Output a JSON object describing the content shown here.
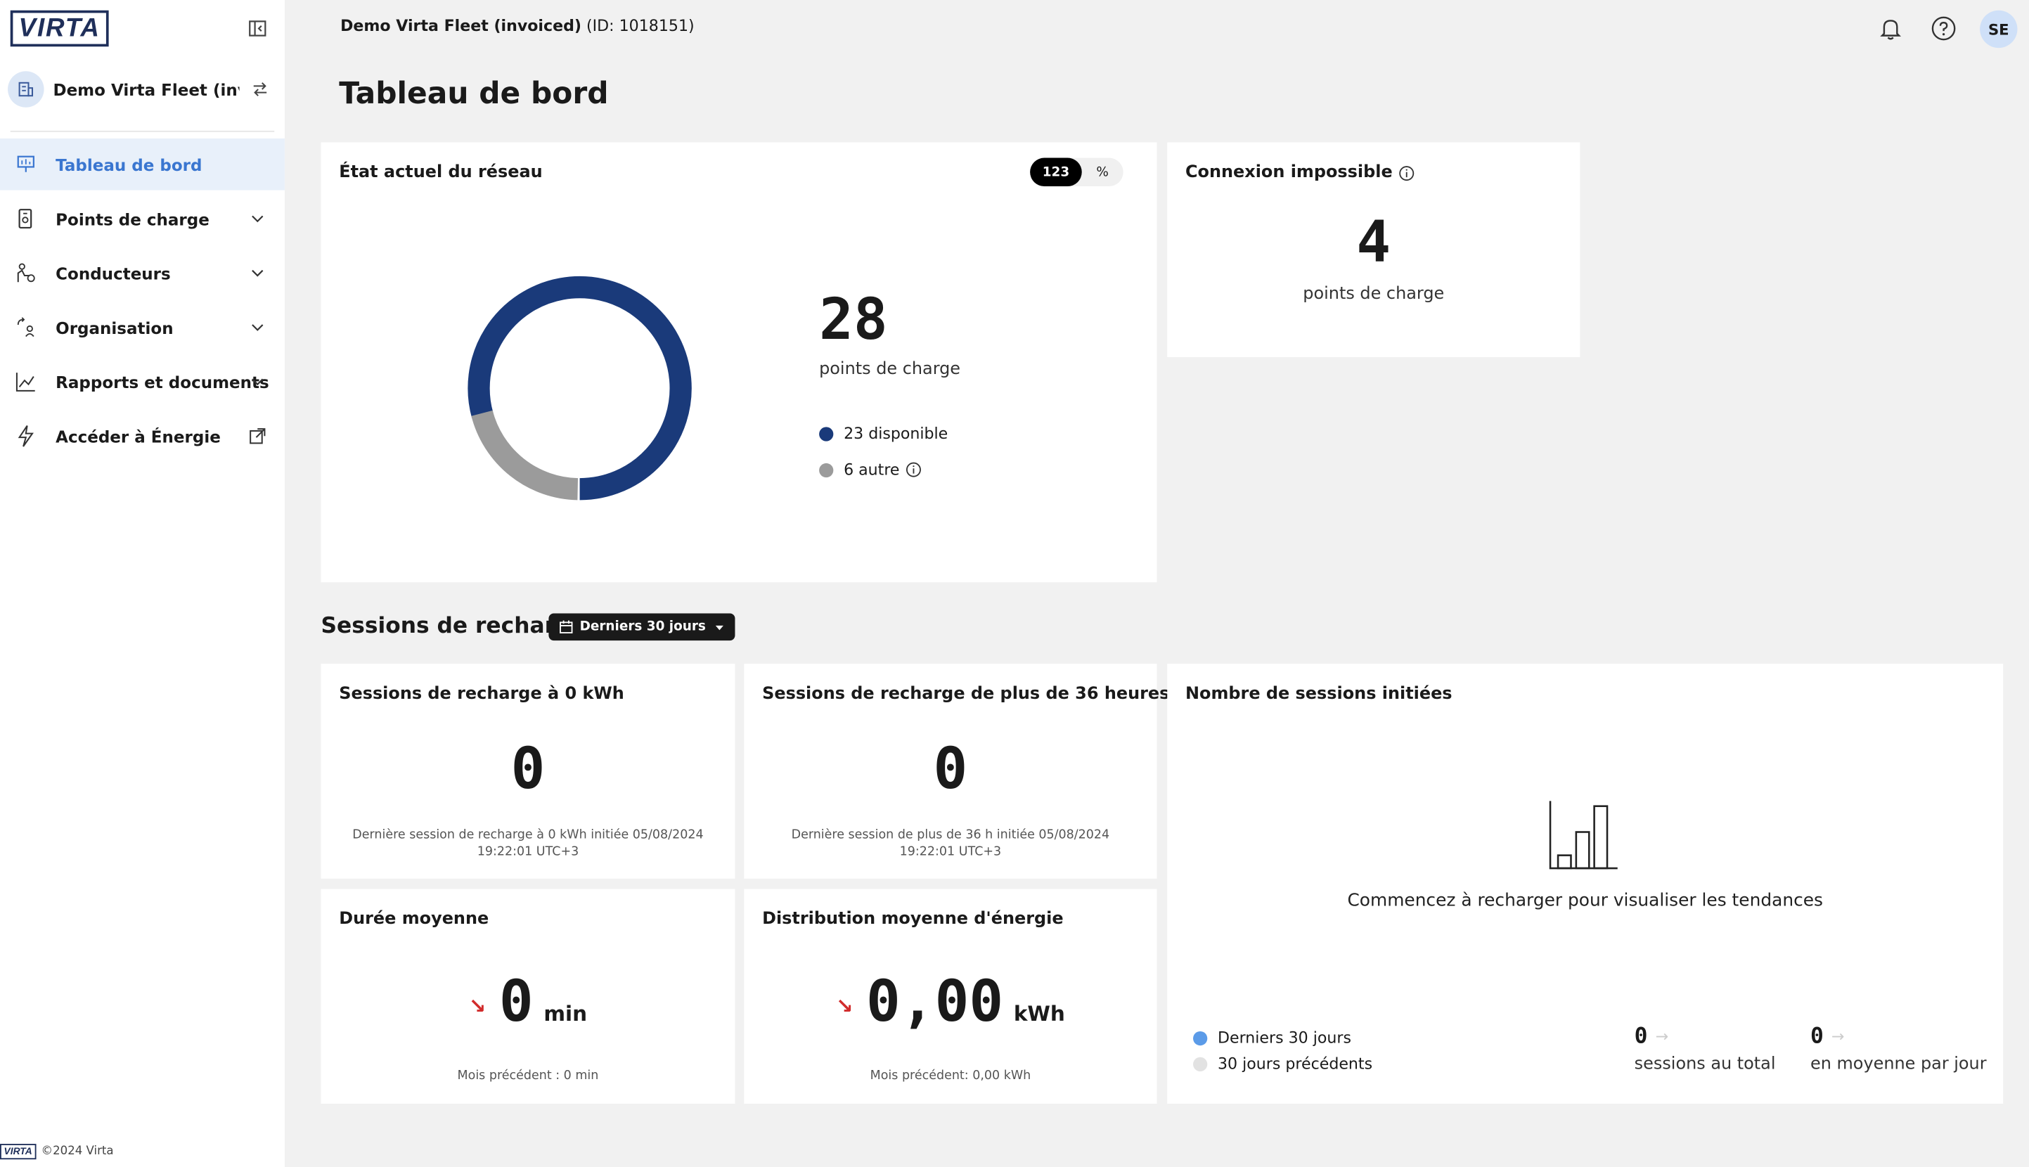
{
  "app": {
    "logo_text": "VIRTA",
    "footer_logo": "VIRTA",
    "footer_text": "©2024 Virta"
  },
  "org": {
    "name": "Demo Virta Fleet (invoi..."
  },
  "topbar": {
    "org_name": "Demo Virta Fleet (invoiced)",
    "org_id": "(ID: 1018151)",
    "avatar_initials": "SE"
  },
  "nav": {
    "items": [
      {
        "label": "Tableau de bord",
        "icon": "presentation-icon"
      },
      {
        "label": "Points de charge",
        "icon": "charger-icon"
      },
      {
        "label": "Conducteurs",
        "icon": "driver-icon"
      },
      {
        "label": "Organisation",
        "icon": "organisation-icon"
      },
      {
        "label": "Rapports et documents",
        "icon": "chart-line-icon"
      },
      {
        "label": "Accéder à Énergie",
        "icon": "lightning-icon"
      }
    ]
  },
  "page": {
    "title": "Tableau de bord"
  },
  "network": {
    "title": "État actuel du réseau",
    "toggle_count": "123",
    "toggle_percent": "%",
    "total": "28",
    "total_label": "points de charge",
    "legend_available": "23 disponible",
    "legend_other": "6 autre",
    "colors": {
      "available": "#1a3a7a",
      "other": "#9b9b9b"
    }
  },
  "chart_data": {
    "type": "pie",
    "categories": [
      "disponible",
      "autre"
    ],
    "values": [
      23,
      6
    ]
  },
  "connection": {
    "title": "Connexion impossible",
    "value": "4",
    "label": "points de charge"
  },
  "sessions": {
    "title": "Sessions de recharge",
    "period": "Derniers 30 jours",
    "zero_kwh": {
      "title": "Sessions de recharge à 0 kWh",
      "value": "0",
      "note_line1": "Dernière session de recharge à 0 kWh initiée 05/08/2024",
      "note_line2": "19:22:01 UTC+3"
    },
    "over_36h": {
      "title": "Sessions de recharge de plus de 36 heures",
      "value": "0",
      "note_line1": "Dernière session de plus de 36 h initiée 05/08/2024",
      "note_line2": "19:22:01 UTC+3"
    },
    "avg_duration": {
      "title": "Durée moyenne",
      "value": "0",
      "unit": "min",
      "prev": "Mois précédent : 0 min"
    },
    "avg_energy": {
      "title": "Distribution moyenne d'énergie",
      "value": "0,00",
      "unit": "kWh",
      "prev": "Mois précédent: 0,00 kWh"
    },
    "initiated": {
      "title": "Nombre de sessions initiées",
      "empty_text": "Commencez à recharger pour visualiser les tendances",
      "legend_current": "Derniers 30 jours",
      "legend_previous": "30 jours précédents",
      "total_value": "0",
      "total_label": "sessions au total",
      "avg_value": "0",
      "avg_label": "en moyenne par jour",
      "colors": {
        "current": "#5b9be8",
        "previous": "#e2e2e2"
      }
    }
  }
}
